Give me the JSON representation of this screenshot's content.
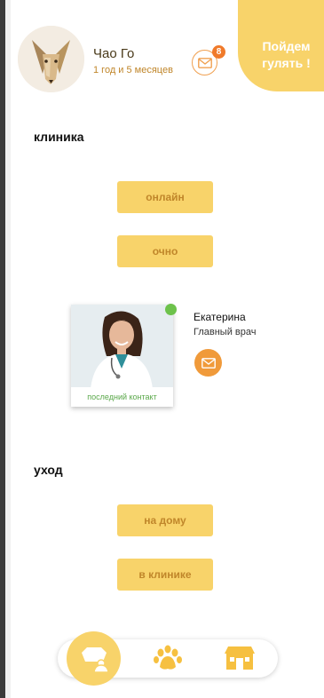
{
  "profile": {
    "pet_name": "Чао Го",
    "pet_age": "1 год и 5 месяцев",
    "messages_count": "8"
  },
  "walk_button": {
    "line1": "Пойдем",
    "line2": "гулять !"
  },
  "clinic": {
    "title": "клиника",
    "online_label": "онлайн",
    "in_person_label": "очно"
  },
  "doctor": {
    "name": "Екатерина",
    "role": "Главный врач",
    "caption": "последний контакт",
    "status": "online"
  },
  "care": {
    "title": "уход",
    "home_label": "на дому",
    "clinic_label": "в клинике"
  },
  "nav": {
    "items": [
      {
        "icon": "pet-medical-icon",
        "active": true
      },
      {
        "icon": "paw-icon",
        "active": false
      },
      {
        "icon": "house-icon",
        "active": false
      }
    ]
  },
  "colors": {
    "accent": "#f8d36a",
    "accent_text": "#c0862a",
    "orange": "#f09a3a",
    "online": "#6dc24b"
  }
}
